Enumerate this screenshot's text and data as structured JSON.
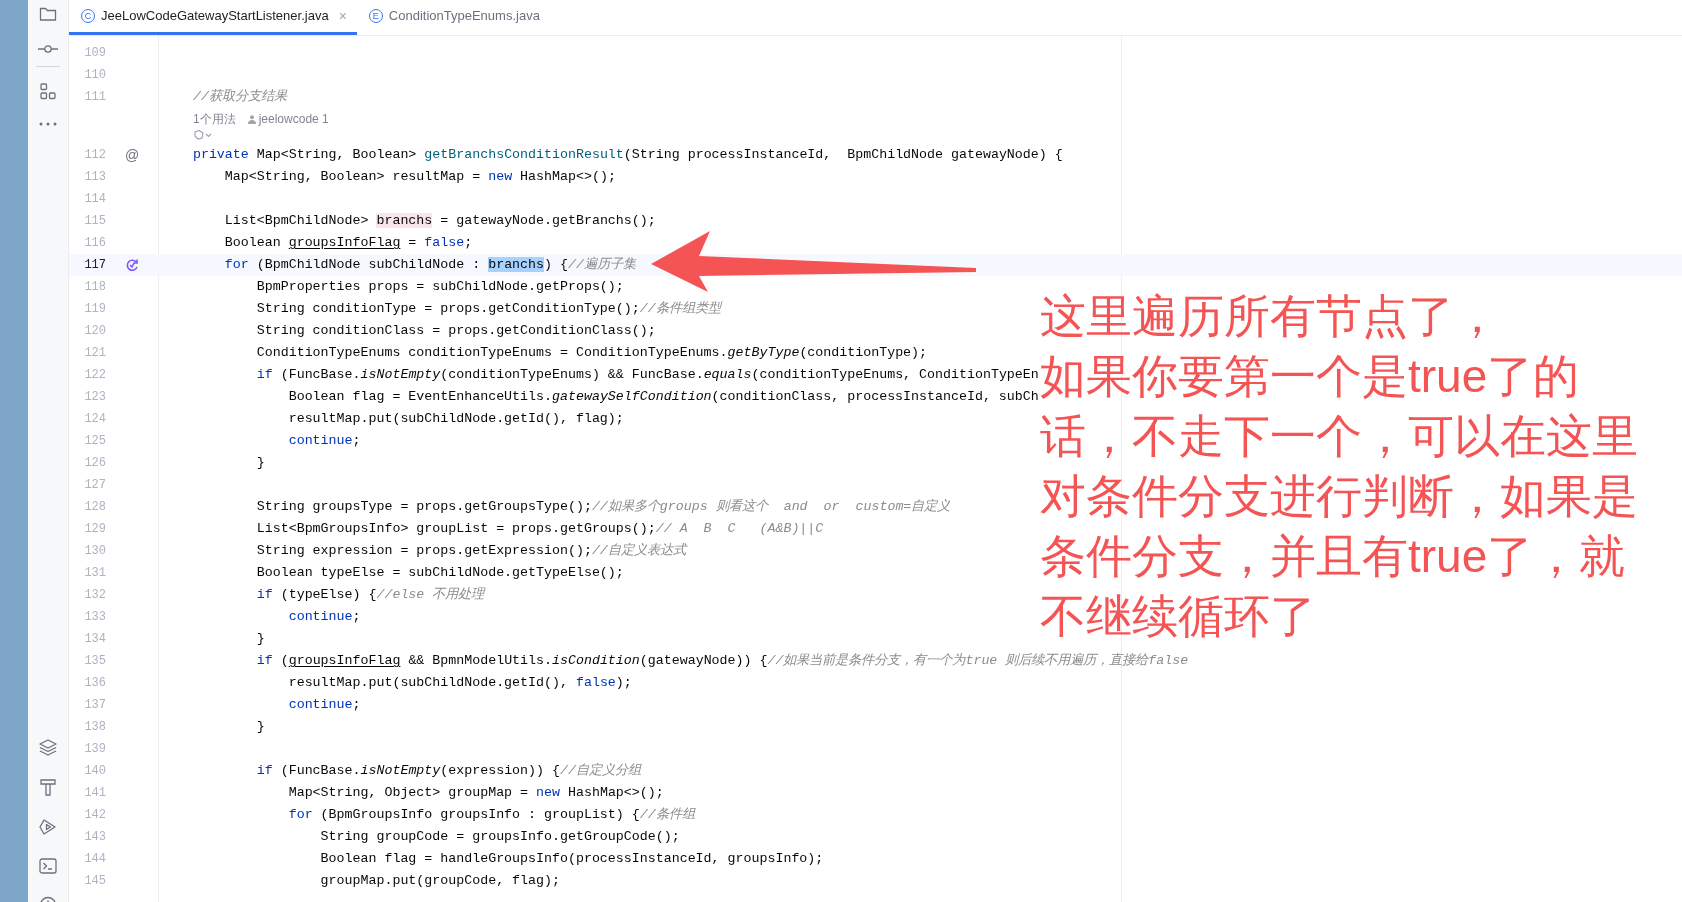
{
  "tabs": [
    {
      "badge": "C",
      "label": "JeeLowCodeGatewayStartListener.java",
      "close": "×",
      "selected": true
    },
    {
      "badge": "E",
      "label": "ConditionTypeEnums.java",
      "selected": false
    }
  ],
  "editor": {
    "lines": [
      {
        "number": "109"
      },
      {
        "number": "110"
      },
      {
        "number": "111",
        "tokens": [
          {
            "kind": "comment",
            "text": "    //获取分支结果"
          }
        ]
      },
      {
        "number": "112",
        "gutter": {
          "kind": "mark",
          "text": "@"
        },
        "hints": {
          "usages": "1个用法",
          "author": "jeelowcode 1"
        },
        "tokens": [
          {
            "kind": "keyword",
            "text": "    private"
          },
          {
            "kind": "text",
            "text": " Map<String, Boolean> "
          },
          {
            "kind": "declaration",
            "text": "getBranchsConditionResult"
          },
          {
            "kind": "text",
            "text": "(String processInstanceId,  BpmChildNode gatewayNode) {"
          }
        ]
      },
      {
        "number": "113",
        "tokens": [
          {
            "kind": "text",
            "text": "        Map<String, Boolean> resultMap = "
          },
          {
            "kind": "keyword",
            "text": "new"
          },
          {
            "kind": "text",
            "text": " HashMap<>();"
          }
        ]
      },
      {
        "number": "114"
      },
      {
        "number": "115",
        "tokens": [
          {
            "kind": "text",
            "text": "        List<BpmChildNode> "
          },
          {
            "kind": "unused",
            "text": "branchs"
          },
          {
            "kind": "text",
            "text": " = gatewayNode.getBranchs();"
          }
        ]
      },
      {
        "number": "116",
        "tokens": [
          {
            "kind": "text",
            "text": "        Boolean "
          },
          {
            "kind": "reassigned",
            "text": "groupsInfoFlag"
          },
          {
            "kind": "text",
            "text": " = "
          },
          {
            "kind": "keyword",
            "text": "false"
          },
          {
            "kind": "text",
            "text": ";"
          }
        ]
      },
      {
        "number": "117",
        "current": true,
        "gutter": {
          "kind": "recursion"
        },
        "tokens": [
          {
            "kind": "keyword",
            "text": "        for"
          },
          {
            "kind": "text",
            "text": " (BpmChildNode subChildNode : "
          },
          {
            "kind": "selection",
            "text": "branchs"
          },
          {
            "kind": "text",
            "text": ") {"
          },
          {
            "kind": "comment",
            "text": "//遍历子集"
          }
        ]
      },
      {
        "number": "118",
        "tokens": [
          {
            "kind": "text",
            "text": "            BpmProperties props = subChildNode.getProps();"
          }
        ]
      },
      {
        "number": "119",
        "tokens": [
          {
            "kind": "text",
            "text": "            String conditionType = props.getConditionType();"
          },
          {
            "kind": "comment",
            "text": "//条件组类型"
          }
        ]
      },
      {
        "number": "120",
        "tokens": [
          {
            "kind": "text",
            "text": "            String conditionClass = props.getConditionClass();"
          }
        ]
      },
      {
        "number": "121",
        "tokens": [
          {
            "kind": "text",
            "text": "            ConditionTypeEnums conditionTypeEnums = ConditionTypeEnums."
          },
          {
            "kind": "static_call",
            "text": "getByType"
          },
          {
            "kind": "text",
            "text": "(conditionType);"
          }
        ]
      },
      {
        "number": "122",
        "tokens": [
          {
            "kind": "keyword",
            "text": "            if"
          },
          {
            "kind": "text",
            "text": " (FuncBase."
          },
          {
            "kind": "static_call",
            "text": "isNotEmpty"
          },
          {
            "kind": "text",
            "text": "(conditionTypeEnums) && FuncBase."
          },
          {
            "kind": "static_call",
            "text": "equals"
          },
          {
            "kind": "text",
            "text": "(conditionTypeEnums, ConditionTypeEn"
          }
        ]
      },
      {
        "number": "123",
        "tokens": [
          {
            "kind": "text",
            "text": "                Boolean flag = EventEnhanceUtils."
          },
          {
            "kind": "static_call",
            "text": "gatewaySelfCondition"
          },
          {
            "kind": "text",
            "text": "(conditionClass, processInstanceId, subCh"
          }
        ]
      },
      {
        "number": "124",
        "tokens": [
          {
            "kind": "text",
            "text": "                resultMap.put(subChildNode.getId(), flag);"
          }
        ]
      },
      {
        "number": "125",
        "tokens": [
          {
            "kind": "keyword",
            "text": "                continue"
          },
          {
            "kind": "text",
            "text": ";"
          }
        ]
      },
      {
        "number": "126",
        "tokens": [
          {
            "kind": "text",
            "text": "            }"
          }
        ]
      },
      {
        "number": "127"
      },
      {
        "number": "128",
        "tokens": [
          {
            "kind": "text",
            "text": "            String groupsType = props.getGroupsType();"
          },
          {
            "kind": "comment",
            "text": "//如果多个groups 则看这个  and  or  custom=自定义"
          }
        ]
      },
      {
        "number": "129",
        "tokens": [
          {
            "kind": "text",
            "text": "            List<BpmGroupsInfo> groupList = props.getGroups();"
          },
          {
            "kind": "comment",
            "text": "// A  B  C   (A&B)||C"
          }
        ]
      },
      {
        "number": "130",
        "tokens": [
          {
            "kind": "text",
            "text": "            String expression = props.getExpression();"
          },
          {
            "kind": "comment",
            "text": "//自定义表达式"
          }
        ]
      },
      {
        "number": "131",
        "tokens": [
          {
            "kind": "text",
            "text": "            Boolean typeElse = subChildNode.getTypeElse();"
          }
        ]
      },
      {
        "number": "132",
        "tokens": [
          {
            "kind": "keyword",
            "text": "            if"
          },
          {
            "kind": "text",
            "text": " (typeElse) {"
          },
          {
            "kind": "comment",
            "text": "//else 不用处理"
          }
        ]
      },
      {
        "number": "133",
        "tokens": [
          {
            "kind": "keyword",
            "text": "                continue"
          },
          {
            "kind": "text",
            "text": ";"
          }
        ]
      },
      {
        "number": "134",
        "tokens": [
          {
            "kind": "text",
            "text": "            }"
          }
        ]
      },
      {
        "number": "135",
        "tokens": [
          {
            "kind": "keyword",
            "text": "            if"
          },
          {
            "kind": "text",
            "text": " ("
          },
          {
            "kind": "reassigned",
            "text": "groupsInfoFlag"
          },
          {
            "kind": "text",
            "text": " && BpmnModelUtils."
          },
          {
            "kind": "static_call",
            "text": "isCondition"
          },
          {
            "kind": "text",
            "text": "(gatewayNode)) {"
          },
          {
            "kind": "comment",
            "text": "//如果当前是条件分支，有一个为true 则后续不用遍历，直接给false"
          }
        ]
      },
      {
        "number": "136",
        "tokens": [
          {
            "kind": "text",
            "text": "                resultMap.put(subChildNode.getId(), "
          },
          {
            "kind": "keyword",
            "text": "false"
          },
          {
            "kind": "text",
            "text": ");"
          }
        ]
      },
      {
        "number": "137",
        "tokens": [
          {
            "kind": "keyword",
            "text": "                continue"
          },
          {
            "kind": "text",
            "text": ";"
          }
        ]
      },
      {
        "number": "138",
        "tokens": [
          {
            "kind": "text",
            "text": "            }"
          }
        ]
      },
      {
        "number": "139"
      },
      {
        "number": "140",
        "tokens": [
          {
            "kind": "keyword",
            "text": "            if"
          },
          {
            "kind": "text",
            "text": " (FuncBase."
          },
          {
            "kind": "static_call",
            "text": "isNotEmpty"
          },
          {
            "kind": "text",
            "text": "(expression)) {"
          },
          {
            "kind": "comment",
            "text": "//自定义分组"
          }
        ]
      },
      {
        "number": "141",
        "tokens": [
          {
            "kind": "text",
            "text": "                Map<String, Object> groupMap = "
          },
          {
            "kind": "keyword",
            "text": "new"
          },
          {
            "kind": "text",
            "text": " HashMap<>();"
          }
        ]
      },
      {
        "number": "142",
        "tokens": [
          {
            "kind": "keyword",
            "text": "                for"
          },
          {
            "kind": "text",
            "text": " (BpmGroupsInfo groupsInfo : groupList) {"
          },
          {
            "kind": "comment",
            "text": "//条件组"
          }
        ]
      },
      {
        "number": "143",
        "tokens": [
          {
            "kind": "text",
            "text": "                    String groupCode = groupsInfo.getGroupCode();"
          }
        ]
      },
      {
        "number": "144",
        "tokens": [
          {
            "kind": "text",
            "text": "                    Boolean flag = handleGroupsInfo(processInstanceId, groupsInfo);"
          }
        ]
      },
      {
        "number": "145",
        "tokens": [
          {
            "kind": "text",
            "text": "                    groupMap.put(groupCode, flag);"
          }
        ]
      }
    ]
  },
  "annotation": {
    "lines": [
      "这里遍历所有节点了，",
      "如果你要第一个是true了的",
      "话，不走下一个，可以在这里",
      "对条件分支进行判断，如果是",
      "条件分支，并且有true了，就",
      "不继续循环了"
    ]
  }
}
